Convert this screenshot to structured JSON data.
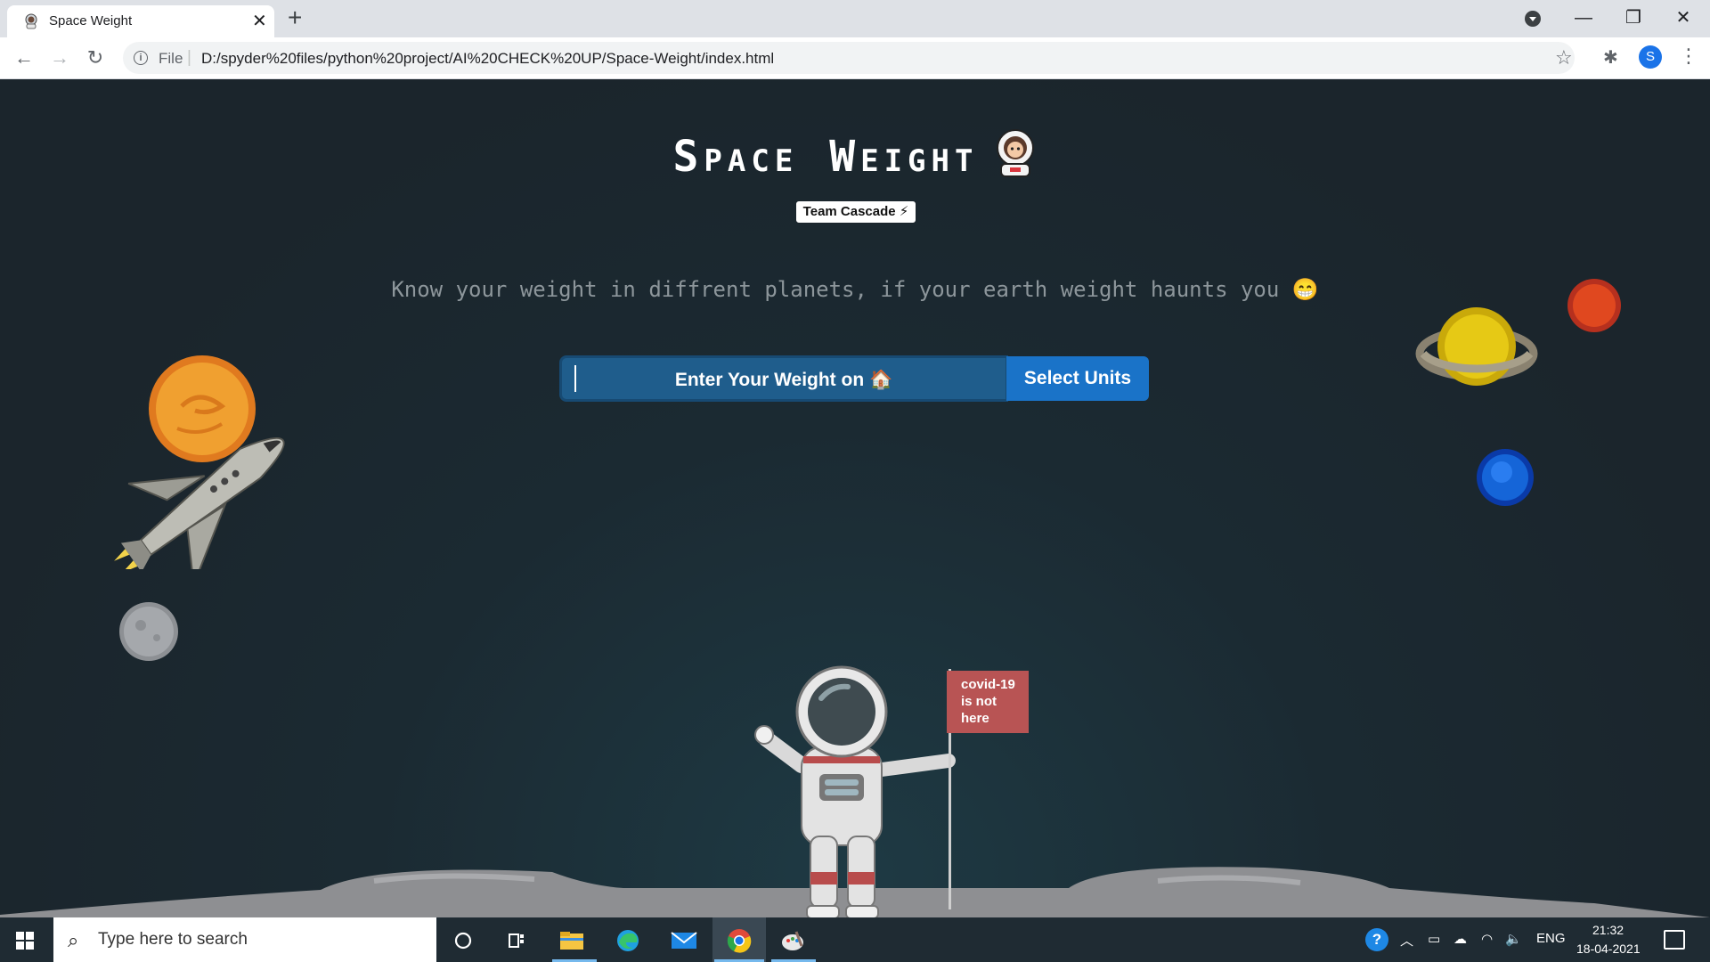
{
  "browser": {
    "tab_title": "Space Weight",
    "tab_close": "✕",
    "new_tab": "+",
    "url_scheme": "File",
    "url_separator": "|",
    "url": "D:/spyder%20files/python%20project/AI%20CHECK%20UP/Space-Weight/index.html",
    "profile_initial": "S",
    "back": "←",
    "forward": "→",
    "reload": "↻",
    "star": "☆",
    "menu": "⋮",
    "extensions": "✱",
    "minimize": "—",
    "maximize": "❐",
    "close": "✕"
  },
  "page": {
    "title": "Space Weight",
    "team_badge": "Team Cascade ⚡",
    "tagline": "Know your weight in diffrent planets, if your earth weight haunts you 😁",
    "weight_input_placeholder": "Enter Your Weight on 🏠",
    "units_button": "Select Units",
    "flag_text": "covid-19 is not here",
    "flag_lines": [
      "covid-19",
      "is not",
      "here"
    ]
  },
  "taskbar": {
    "search_placeholder": "Type here to search",
    "search_icon": "⌕",
    "language": "ENG",
    "time": "21:32",
    "date": "18-04-2021",
    "icons": [
      "cortana-icon",
      "task-view-icon",
      "file-explorer-icon",
      "edge-icon",
      "mail-icon",
      "chrome-icon",
      "paint-icon"
    ]
  },
  "colors": {
    "page_background": "#1b252c",
    "input_background": "#1f5d8c",
    "button_background": "#1a73c8",
    "taskbar": "#1f2b33"
  }
}
